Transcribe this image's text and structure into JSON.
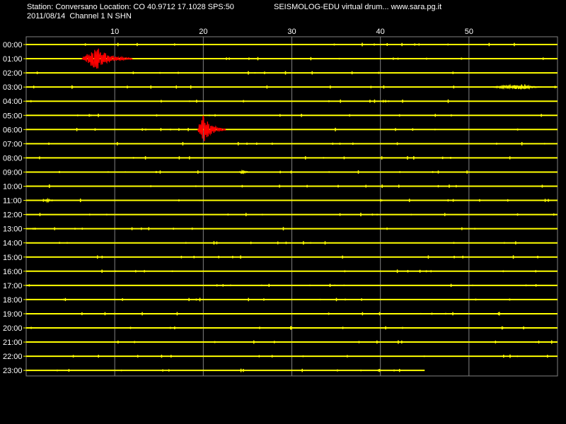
{
  "header": {
    "station_line": "Station: Conversano Location: CO 40.9712 17.1028 SPS:50",
    "date_line": "2011/08/14  Channel 1 N SHN",
    "brand_line": "SEISMOLOG-EDU virtual drum... www.sara.pg.it"
  },
  "colors": {
    "background": "#000000",
    "trace": "#ffff00",
    "event": "#ff0000",
    "grid": "#808080",
    "text": "#ffffff"
  },
  "chart_data": {
    "type": "line",
    "title": "",
    "xlabel": "",
    "ylabel": "",
    "xlim": [
      0,
      60
    ],
    "x_ticks": [
      10,
      20,
      30,
      40,
      50
    ],
    "grid": true,
    "rows": [
      "00:00",
      "01:00",
      "02:00",
      "03:00",
      "04:00",
      "05:00",
      "06:00",
      "07:00",
      "08:00",
      "09:00",
      "10:00",
      "11:00",
      "12:00",
      "13:00",
      "14:00",
      "15:00",
      "16:00",
      "17:00",
      "18:00",
      "19:00",
      "20:00",
      "21:00",
      "22:00",
      "23:00"
    ],
    "last_row_end_minute": 45,
    "events": [
      {
        "row": "01:00",
        "start_min": 6.3,
        "peak_min": 8.1,
        "end_min": 12.0,
        "color": "red",
        "amplitude": 16
      },
      {
        "row": "03:00",
        "start_min": 52.5,
        "peak_min": 56.3,
        "end_min": 58.2,
        "color": "yellow",
        "amplitude": 4
      },
      {
        "row": "06:00",
        "start_min": 19.4,
        "peak_min": 19.9,
        "end_min": 22.5,
        "color": "red",
        "amplitude": 22
      },
      {
        "row": "09:00",
        "start_min": 24.0,
        "peak_min": 24.5,
        "end_min": 25.2,
        "color": "yellow",
        "amplitude": 3
      },
      {
        "row": "11:00",
        "start_min": 2.0,
        "peak_min": 2.4,
        "end_min": 2.9,
        "color": "yellow",
        "amplitude": 2
      }
    ]
  }
}
